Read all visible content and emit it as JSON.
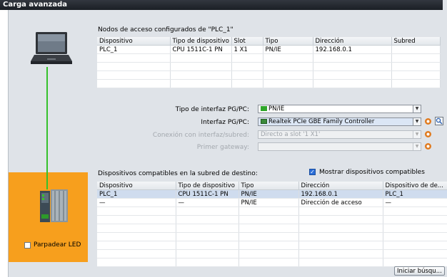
{
  "window": {
    "title": "Carga avanzada"
  },
  "access_nodes": {
    "heading": "Nodos de acceso configurados de \"PLC_1\"",
    "columns": [
      "Dispositivo",
      "Tipo de dispositivo",
      "Slot",
      "Tipo",
      "Dirección",
      "Subred"
    ],
    "rows": [
      [
        "PLC_1",
        "CPU 1511C-1 PN",
        "1 X1",
        "PN/IE",
        "192.168.0.1",
        ""
      ]
    ]
  },
  "interface_settings": {
    "type_label": "Tipo de interfaz PG/PC:",
    "type_value": "PN/IE",
    "interface_label": "Interfaz PG/PC:",
    "interface_value": "Realtek PCIe GBE Family Controller",
    "connection_label": "Conexión con interfaz/subred:",
    "connection_value": "Directo a slot '1 X1'",
    "gateway_label": "Primer gateway:",
    "gateway_value": ""
  },
  "compatible_devices": {
    "heading": "Dispositivos compatibles en la subred de destino:",
    "show_compatible_label": "Mostrar dispositivos compatibles",
    "show_compatible_checked": true,
    "columns": [
      "Dispositivo",
      "Tipo de dispositivo",
      "Tipo",
      "Dirección",
      "Dispositivo de de..."
    ],
    "rows": [
      [
        "PLC_1",
        "CPU 1511C-1 PN",
        "PN/IE",
        "192.168.0.1",
        "PLC_1"
      ],
      [
        "—",
        "—",
        "PN/IE",
        "Dirección de acceso",
        "—"
      ]
    ]
  },
  "blink_led_label": "Parpadear LED",
  "start_search_label": "Iniciar búsqu...",
  "colors": {
    "link_line": "#35c12b",
    "target_panel": "#f79f1d",
    "selection": "#cfdcee"
  }
}
